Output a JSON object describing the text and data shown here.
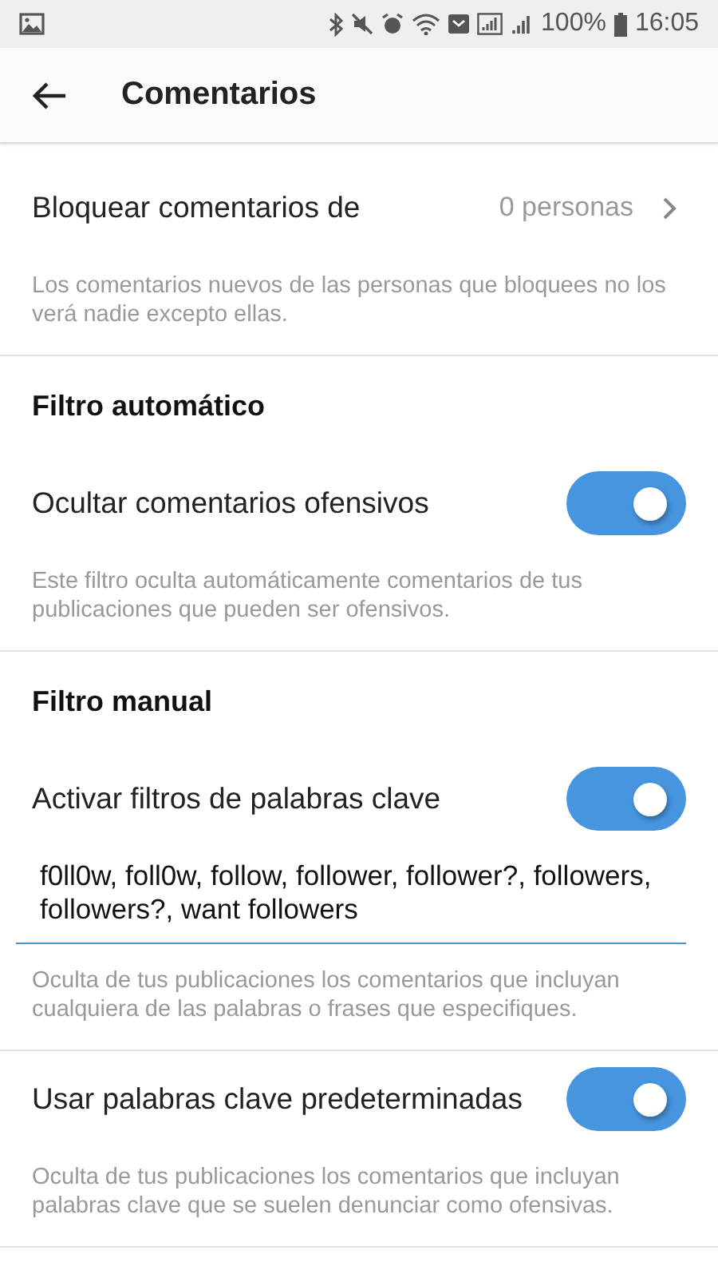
{
  "status_bar": {
    "battery": "100%",
    "time": "16:05"
  },
  "app_bar": {
    "title": "Comentarios"
  },
  "sections": [
    {
      "items": [
        {
          "kind": "link",
          "label": "Bloquear comentarios de",
          "value": "0 personas",
          "description": "Los comentarios nuevos de las personas que bloquees no los verá nadie excepto ellas."
        }
      ]
    },
    {
      "heading": "Filtro automático",
      "items": [
        {
          "kind": "switch",
          "label": "Ocultar comentarios ofensivos",
          "on": true,
          "description": "Este filtro oculta automáticamente comentarios de tus publicaciones que pueden ser ofensivos."
        }
      ]
    },
    {
      "heading": "Filtro manual",
      "items": [
        {
          "kind": "switch",
          "label": "Activar filtros de palabras clave",
          "on": true,
          "keywords": "f0ll0w, foll0w, follow, follower, follower?, followers, followers?, want followers",
          "description": "Oculta de tus publicaciones los comentarios que incluyan cualquiera de las palabras o frases que especifiques."
        },
        {
          "kind": "switch",
          "label": "Usar palabras clave predeterminadas",
          "on": true,
          "description": "Oculta de tus publicaciones los comentarios que incluyan palabras clave que se suelen denunciar como ofensivas."
        }
      ]
    }
  ]
}
